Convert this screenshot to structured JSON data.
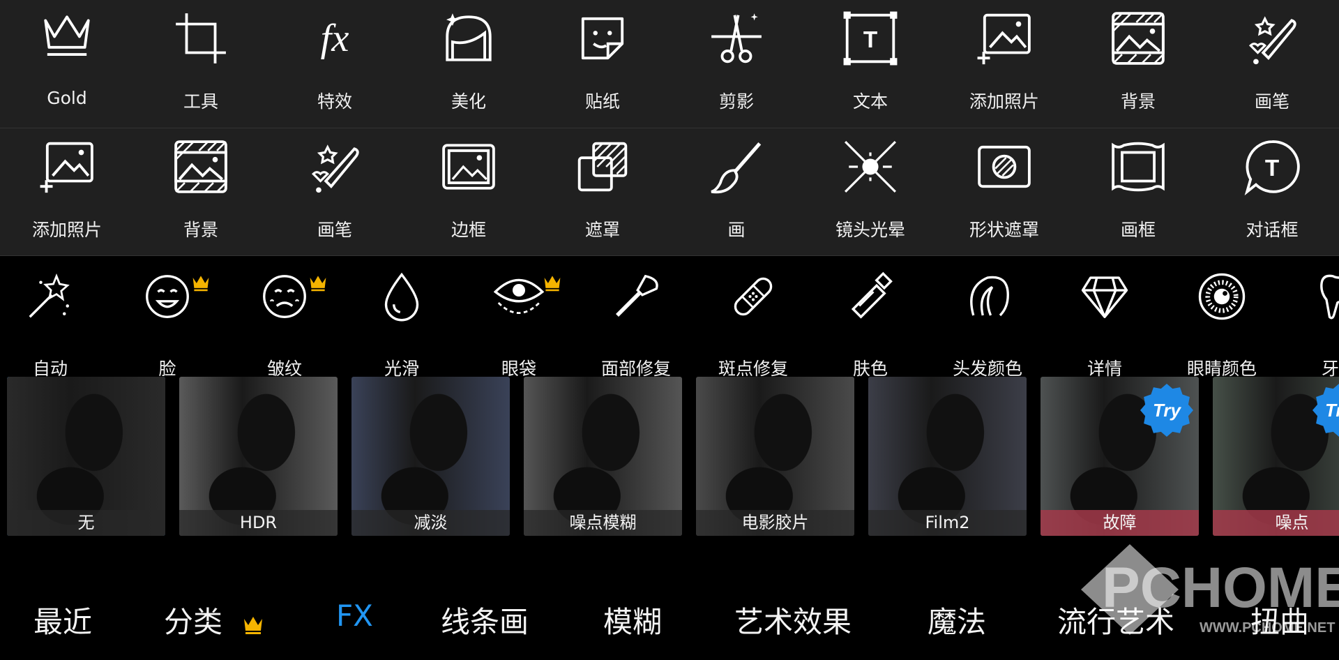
{
  "toolbar_row1": [
    {
      "label": "Gold",
      "icon": "crown-icon"
    },
    {
      "label": "工具",
      "icon": "crop-icon"
    },
    {
      "label": "特效",
      "icon": "fx-icon"
    },
    {
      "label": "美化",
      "icon": "beautify-face-icon"
    },
    {
      "label": "贴纸",
      "icon": "sticker-icon"
    },
    {
      "label": "剪影",
      "icon": "scissors-icon"
    },
    {
      "label": "文本",
      "icon": "text-icon"
    },
    {
      "label": "添加照片",
      "icon": "add-photo-icon"
    },
    {
      "label": "背景",
      "icon": "background-icon"
    },
    {
      "label": "画笔",
      "icon": "brush-icon"
    }
  ],
  "toolbar_row2": [
    {
      "label": "添加照片",
      "icon": "add-photo-icon"
    },
    {
      "label": "背景",
      "icon": "background-icon"
    },
    {
      "label": "画笔",
      "icon": "brush-icon"
    },
    {
      "label": "边框",
      "icon": "border-icon"
    },
    {
      "label": "遮罩",
      "icon": "mask-icon"
    },
    {
      "label": "画",
      "icon": "paintbrush-icon"
    },
    {
      "label": "镜头光晕",
      "icon": "lens-flare-icon"
    },
    {
      "label": "形状遮罩",
      "icon": "shape-mask-icon"
    },
    {
      "label": "画框",
      "icon": "frame-icon"
    },
    {
      "label": "对话框",
      "icon": "speech-bubble-icon"
    }
  ],
  "beauty_tools": [
    {
      "label": "自动",
      "icon": "magic-wand-icon",
      "premium": false
    },
    {
      "label": "脸",
      "icon": "smile-face-icon",
      "premium": true
    },
    {
      "label": "皱纹",
      "icon": "wrinkle-face-icon",
      "premium": true
    },
    {
      "label": "光滑",
      "icon": "droplet-icon",
      "premium": false
    },
    {
      "label": "眼袋",
      "icon": "eye-bag-icon",
      "premium": true
    },
    {
      "label": "面部修复",
      "icon": "makeup-brush-icon",
      "premium": false
    },
    {
      "label": "斑点修复",
      "icon": "bandage-icon",
      "premium": false
    },
    {
      "label": "肤色",
      "icon": "tube-icon",
      "premium": false
    },
    {
      "label": "头发颜色",
      "icon": "hair-icon",
      "premium": false
    },
    {
      "label": "详情",
      "icon": "diamond-icon",
      "premium": false
    },
    {
      "label": "眼睛颜色",
      "icon": "iris-icon",
      "premium": false
    },
    {
      "label": "牙齿",
      "icon": "tooth-icon",
      "premium": false
    }
  ],
  "effects": [
    {
      "label": "无",
      "selected": true,
      "try": false,
      "tint": "#2a2a2a"
    },
    {
      "label": "HDR",
      "selected": false,
      "try": false,
      "tint": "#5a5a5a"
    },
    {
      "label": "减淡",
      "selected": false,
      "try": false,
      "tint": "#3a4258"
    },
    {
      "label": "噪点模糊",
      "selected": false,
      "try": false,
      "tint": "#555555"
    },
    {
      "label": "电影胶片",
      "selected": false,
      "try": false,
      "tint": "#4a4a4a"
    },
    {
      "label": "Film2",
      "selected": false,
      "try": false,
      "tint": "#3c3e48"
    },
    {
      "label": "故障",
      "selected": false,
      "try": true,
      "tint": "#4e5252"
    },
    {
      "label": "噪点",
      "selected": false,
      "try": true,
      "tint": "#465048"
    }
  ],
  "try_badge": "Try",
  "categories": [
    {
      "label": "最近",
      "active": false,
      "premium": false
    },
    {
      "label": "分类",
      "active": false,
      "premium": true
    },
    {
      "label": "FX",
      "active": true,
      "premium": false
    },
    {
      "label": "线条画",
      "active": false,
      "premium": false
    },
    {
      "label": "模糊",
      "active": false,
      "premium": false
    },
    {
      "label": "艺术效果",
      "active": false,
      "premium": false
    },
    {
      "label": "魔法",
      "active": false,
      "premium": false
    },
    {
      "label": "流行艺术",
      "active": false,
      "premium": false
    },
    {
      "label": "扭曲",
      "active": false,
      "premium": false
    }
  ],
  "watermark": {
    "brand": "PCHOME",
    "url": "WWW.PCHOME.NET"
  },
  "colors": {
    "accent": "#2196f3",
    "crown": "#f5b400",
    "try_badge": "#1e88e5",
    "glitch_bar": "#a33a4a"
  }
}
